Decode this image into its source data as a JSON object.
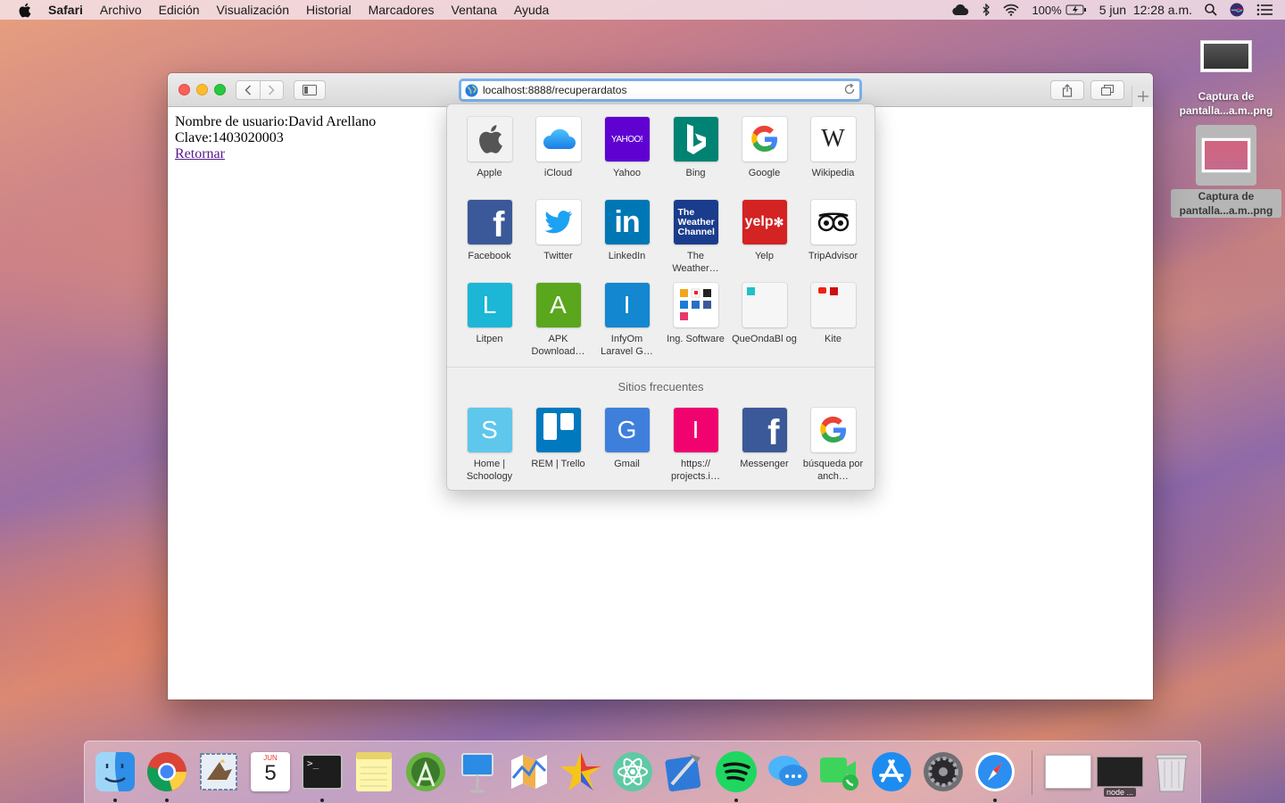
{
  "menubar": {
    "app": "Safari",
    "items": [
      "Archivo",
      "Edición",
      "Visualización",
      "Historial",
      "Marcadores",
      "Ventana",
      "Ayuda"
    ],
    "battery": "100%",
    "datetime": "5 jun  12:28 a.m."
  },
  "desktop": {
    "files": [
      {
        "label": "Captura de\npantalla...a.m..png"
      },
      {
        "label": "Captura de\npantalla...a.m..png"
      }
    ]
  },
  "browser": {
    "url": "localhost:8888/recuperardatos",
    "page": {
      "user_line": "Nombre de usuario:David Arellano",
      "key_line": "Clave:1403020003",
      "back_link": "Retornar"
    }
  },
  "favorites": [
    {
      "label": "Apple",
      "icon": "apple-icon",
      "bg": "#f2f2f2"
    },
    {
      "label": "iCloud",
      "icon": "icloud-icon",
      "bg": "#ffffff"
    },
    {
      "label": "Yahoo",
      "icon": "yahoo-icon",
      "bg": "#5f01d1"
    },
    {
      "label": "Bing",
      "icon": "bing-icon",
      "bg": "#008373"
    },
    {
      "label": "Google",
      "icon": "google-icon",
      "bg": "#ffffff"
    },
    {
      "label": "Wikipedia",
      "icon": "wikipedia-icon",
      "bg": "#ffffff"
    },
    {
      "label": "Facebook",
      "icon": "facebook-icon",
      "bg": "#3b5998"
    },
    {
      "label": "Twitter",
      "icon": "twitter-icon",
      "bg": "#ffffff"
    },
    {
      "label": "LinkedIn",
      "icon": "linkedin-icon",
      "bg": "#0077b5"
    },
    {
      "label": "The Weather…",
      "icon": "weather-channel-icon",
      "bg": "#1a3c8c"
    },
    {
      "label": "Yelp",
      "icon": "yelp-icon",
      "bg": "#d32323"
    },
    {
      "label": "TripAdvisor",
      "icon": "tripadvisor-icon",
      "bg": "#ffffff"
    },
    {
      "label": "Litpen",
      "icon": "letter-l-icon",
      "bg": "#1cb6d6"
    },
    {
      "label": "APK Download…",
      "icon": "letter-a-icon",
      "bg": "#5aa61c"
    },
    {
      "label": "InfyOm Laravel G…",
      "icon": "letter-i-icon",
      "bg": "#1387cf"
    },
    {
      "label": "Ing. Software",
      "icon": "ing-software-icon",
      "bg": "#ffffff"
    },
    {
      "label": "QueOndaBl og",
      "icon": "queonda-icon",
      "bg": "#f6f6f6"
    },
    {
      "label": "Kite",
      "icon": "kite-icon",
      "bg": "#f6f6f6"
    }
  ],
  "favorite_texts": {
    "yahoo": "YAHOO!",
    "weather": "The\nWeather\nChannel",
    "yelp": "yelp",
    "wikipedia": "W",
    "google": "G",
    "facebook": "f",
    "linkedin": "in",
    "litpen": "L",
    "apk": "A",
    "infyom": "I"
  },
  "frequent": {
    "title": "Sitios frecuentes",
    "items": [
      {
        "label": "Home | Schoology",
        "letter": "S",
        "bg": "#5fc7ec"
      },
      {
        "label": "REM | Trello",
        "letter": "",
        "bg": "#0079bf"
      },
      {
        "label": "Gmail",
        "letter": "G",
        "bg": "#3f7fdc"
      },
      {
        "label": "https:// projects.i…",
        "letter": "I",
        "bg": "#f0036f"
      },
      {
        "label": "Messenger",
        "letter": "f",
        "bg": "#3b5998"
      },
      {
        "label": "búsqueda por anch…",
        "letter": "G",
        "bg": "#ffffff"
      }
    ]
  },
  "dock": {
    "calendar_month": "JUN",
    "calendar_day": "5",
    "terminal_prompt": ">_",
    "node_label": "node ..."
  }
}
